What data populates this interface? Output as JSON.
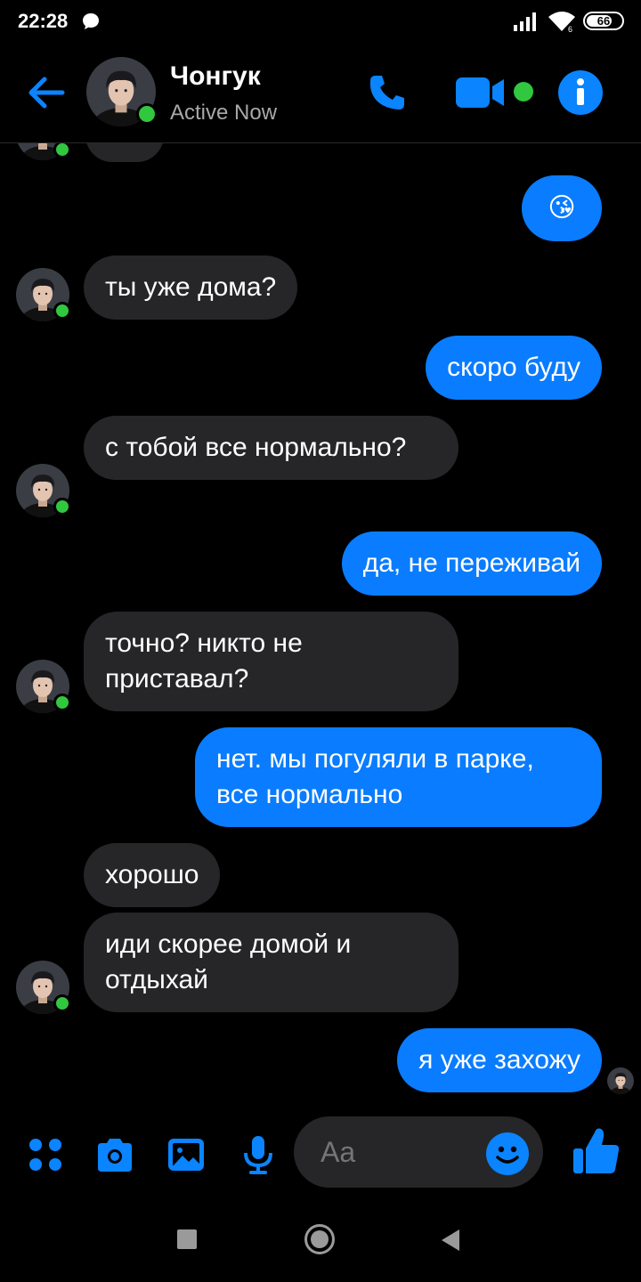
{
  "status_bar": {
    "time": "22:28",
    "battery": "66"
  },
  "header": {
    "contact_name": "Чонгук",
    "contact_status": "Active Now"
  },
  "messages": [
    {
      "from": "me",
      "text": "😘"
    },
    {
      "from": "them",
      "text": "ты уже дома?"
    },
    {
      "from": "me",
      "text": "скоро буду"
    },
    {
      "from": "them",
      "text": "с тобой все нормально?"
    },
    {
      "from": "me",
      "text": "да, не переживай"
    },
    {
      "from": "them",
      "text": "точно? никто не приставал?"
    },
    {
      "from": "me",
      "text": "нет. мы погуляли в парке, все нормально"
    },
    {
      "from": "them",
      "text": "хорошо"
    },
    {
      "from": "them",
      "text": "иди скорее домой и отдыхай"
    },
    {
      "from": "me",
      "text": "я уже захожу"
    }
  ],
  "composer": {
    "placeholder": "Aa"
  },
  "colors": {
    "accent": "#0a84ff",
    "outgoing_bubble": "#0a7cff",
    "incoming_bubble": "#262628",
    "online": "#31c73e",
    "background": "#000000"
  },
  "icons": [
    "back-arrow-icon",
    "phone-icon",
    "video-camera-icon",
    "info-icon",
    "apps-grid-icon",
    "camera-icon",
    "gallery-icon",
    "microphone-icon",
    "smiley-icon",
    "thumbs-up-icon",
    "nav-square-icon",
    "nav-circle-icon",
    "nav-back-icon"
  ]
}
